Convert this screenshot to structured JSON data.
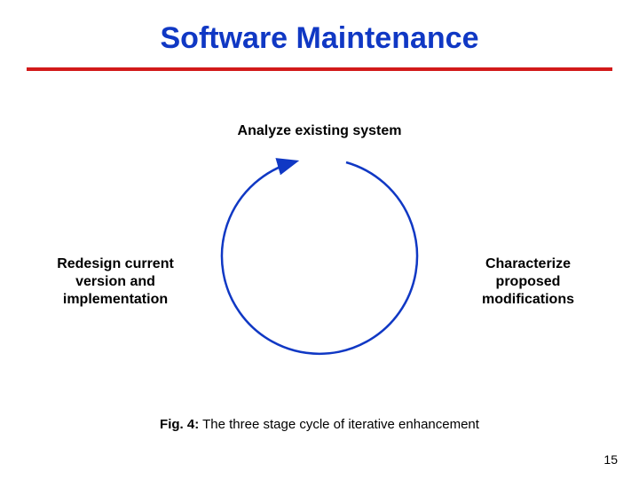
{
  "title": "Software Maintenance",
  "labels": {
    "top": "Analyze existing system",
    "right": "Characterize proposed modifications",
    "left": "Redesign current version and implementation"
  },
  "caption_bold": "Fig. 4:",
  "caption_rest": " The three stage cycle of iterative enhancement",
  "page_number": "15",
  "colors": {
    "title": "#1038c4",
    "rule": "#d21a1a",
    "cycle": "#1038c4"
  },
  "chart_data": {
    "type": "cycle-diagram",
    "stages": [
      "Analyze existing system",
      "Characterize proposed modifications",
      "Redesign current version and implementation"
    ],
    "direction": "clockwise",
    "title": "The three stage cycle of iterative enhancement"
  }
}
